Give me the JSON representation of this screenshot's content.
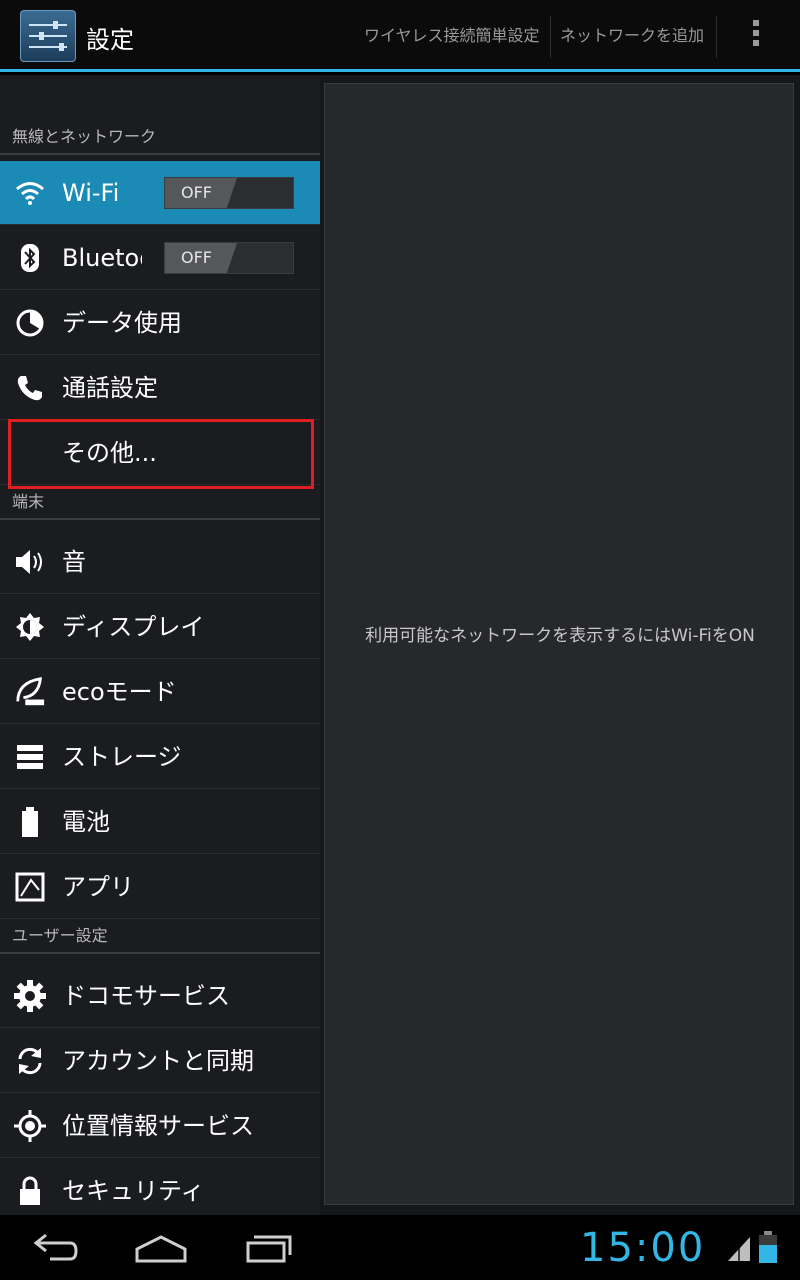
{
  "header": {
    "title": "設定",
    "actions": [
      "ワイヤレス接続簡単設定",
      "ネットワークを追加"
    ],
    "overflow_icon": "overflow-menu-icon"
  },
  "accent_color": "#33b5e5",
  "selected_color": "#1b8ab5",
  "sections": {
    "wireless": "無線とネットワーク",
    "device": "端末",
    "personal": "ユーザー設定"
  },
  "items": {
    "wifi": {
      "label": "Wi-Fi",
      "toggle": "OFF",
      "icon": "wifi-icon"
    },
    "bluetooth": {
      "label": "Bluetooth",
      "toggle": "OFF",
      "icon": "bluetooth-icon"
    },
    "data_usage": {
      "label": "データ使用",
      "icon": "data-usage-icon"
    },
    "call": {
      "label": "通話設定",
      "icon": "phone-icon"
    },
    "more": {
      "label": "その他..."
    },
    "sound": {
      "label": "音",
      "icon": "speaker-icon"
    },
    "display": {
      "label": "ディスプレイ",
      "icon": "brightness-icon"
    },
    "eco": {
      "label": "ecoモード",
      "icon": "eco-leaf-icon"
    },
    "storage": {
      "label": "ストレージ",
      "icon": "storage-icon"
    },
    "battery": {
      "label": "電池",
      "icon": "battery-icon"
    },
    "apps": {
      "label": "アプリ",
      "icon": "apps-icon"
    },
    "docomo": {
      "label": "ドコモサービス",
      "icon": "gear-icon"
    },
    "accounts": {
      "label": "アカウントと同期",
      "icon": "sync-icon"
    },
    "location": {
      "label": "位置情報サービス",
      "icon": "location-icon"
    },
    "security": {
      "label": "セキュリティ",
      "icon": "lock-icon"
    }
  },
  "detail": {
    "message": "利用可能なネットワークを表示するにはWi-FiをON"
  },
  "status": {
    "time": "15:00"
  }
}
